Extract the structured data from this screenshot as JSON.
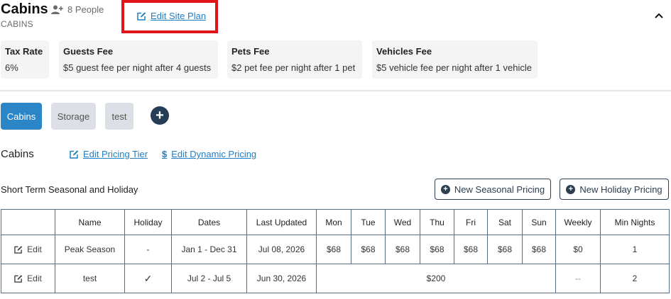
{
  "header": {
    "title": "Cabins",
    "people_text": "8 People",
    "subtitle": "CABINS",
    "edit_site_plan_label": "Edit Site Plan"
  },
  "fees": [
    {
      "title": "Tax Rate",
      "value": "6%"
    },
    {
      "title": "Guests Fee",
      "value": "$5 guest fee per night after 4 guests"
    },
    {
      "title": "Pets Fee",
      "value": "$2 pet fee per night after 1 pet"
    },
    {
      "title": "Vehicles Fee",
      "value": "$5 vehicle fee per night after 1 vehicle"
    }
  ],
  "tabs": [
    {
      "label": "Cabins",
      "active": true
    },
    {
      "label": "Storage",
      "active": false
    },
    {
      "label": "test",
      "active": false
    }
  ],
  "add_tab_symbol": "+",
  "section": {
    "title": "Cabins",
    "edit_pricing_tier": "Edit Pricing Tier",
    "edit_dynamic_pricing": "Edit Dynamic Pricing",
    "dollar_symbol": "$"
  },
  "pricing": {
    "heading": "Short Term Seasonal and Holiday",
    "new_seasonal_label": "New Seasonal Pricing",
    "new_holiday_label": "New Holiday Pricing",
    "columns": [
      "",
      "Name",
      "Holiday",
      "Dates",
      "Last Updated",
      "Mon",
      "Tue",
      "Wed",
      "Thu",
      "Fri",
      "Sat",
      "Sun",
      "Weekly",
      "Min Nights"
    ],
    "rows": [
      {
        "edit_label": "Edit",
        "name": "Peak Season",
        "holiday": "-",
        "dates": "Jan 1 - Dec 31",
        "last_updated": "Jul 08, 2026",
        "mon": "$68",
        "tue": "$68",
        "wed": "$68",
        "thu": "$68",
        "fri": "$68",
        "sat": "$68",
        "sun": "$68",
        "weekly": "$0",
        "min_nights": "1"
      },
      {
        "edit_label": "Edit",
        "name": "test",
        "holiday": "✓",
        "dates": "Jul 2 - Jul 5",
        "last_updated": "Jun 30, 2026",
        "flat_rate": "$200",
        "weekly": "--",
        "min_nights": "2"
      }
    ]
  },
  "colors": {
    "accent": "#2a86c6",
    "link": "#1e7fc4",
    "highlight_border": "#e0151c",
    "dark_button": "#253d55"
  }
}
